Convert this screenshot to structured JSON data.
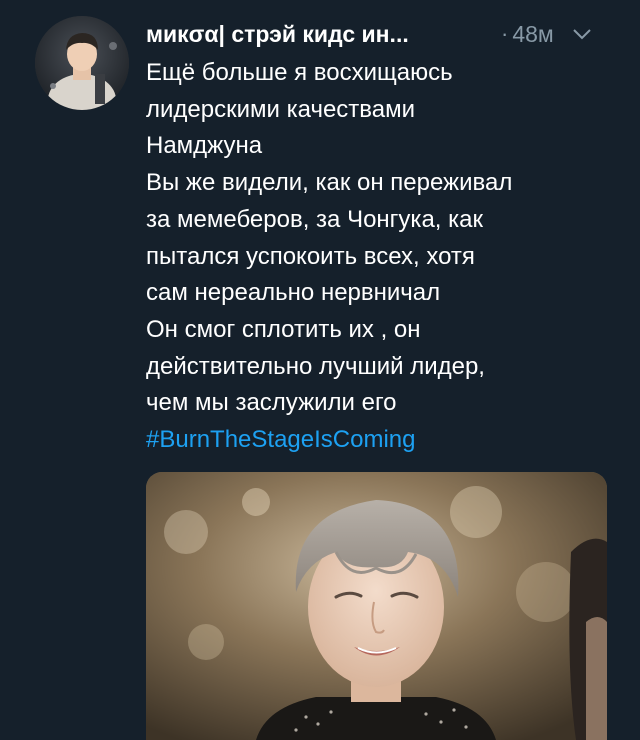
{
  "tweet": {
    "display_name": "микσα| стрэй кидс ин...",
    "separator": "·",
    "timestamp": "48м",
    "text_lines": [
      "Ещё больше я восхищаюсь",
      "лидерскими качествами",
      "Намджуна",
      "Вы же видели, как он переживал",
      "за мемеберов, за Чонгука, как",
      "пытался успокоить всех, хотя",
      "сам нереально нервничал",
      "Он смог сплотить их , он",
      "действительно лучший лидер,",
      "чем мы заслужили его"
    ],
    "hashtag": "#BurnTheStageIsComing"
  },
  "colors": {
    "background": "#15202b",
    "text": "#ffffff",
    "secondary": "#8899a6",
    "link": "#1da1f2"
  },
  "icons": {
    "menu": "chevron-down-icon"
  }
}
